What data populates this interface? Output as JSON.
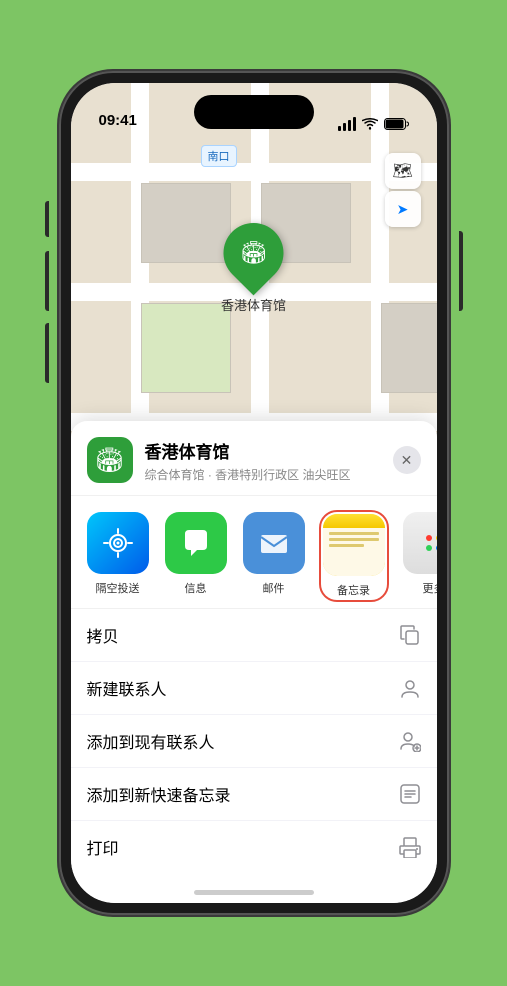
{
  "status_bar": {
    "time": "09:41",
    "location_arrow": "▶"
  },
  "map": {
    "label": "南口",
    "pin_label": "香港体育馆",
    "controls": {
      "map_type_icon": "🗺",
      "location_icon": "➤"
    }
  },
  "venue": {
    "name": "香港体育馆",
    "subtitle": "综合体育馆 · 香港特别行政区 油尖旺区",
    "icon": "🏟"
  },
  "share_apps": [
    {
      "id": "airdrop",
      "label": "隔空投送",
      "class": "app-airdrop"
    },
    {
      "id": "messages",
      "label": "信息",
      "class": "app-messages"
    },
    {
      "id": "mail",
      "label": "邮件",
      "class": "app-mail"
    },
    {
      "id": "notes",
      "label": "备忘录",
      "class": "app-notes"
    },
    {
      "id": "more",
      "label": "更多",
      "class": "app-more"
    }
  ],
  "actions": [
    {
      "id": "copy",
      "label": "拷贝",
      "icon": "⎘"
    },
    {
      "id": "new-contact",
      "label": "新建联系人",
      "icon": "👤"
    },
    {
      "id": "add-existing",
      "label": "添加到现有联系人",
      "icon": "👤"
    },
    {
      "id": "add-notes",
      "label": "添加到新快速备忘录",
      "icon": "📝"
    },
    {
      "id": "print",
      "label": "打印",
      "icon": "🖨"
    }
  ],
  "close_label": "✕"
}
